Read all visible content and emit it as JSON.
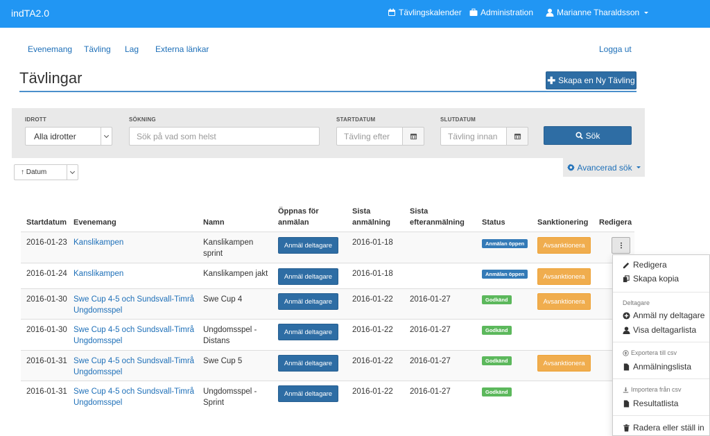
{
  "app": {
    "title": "indTA2.0",
    "nav": {
      "calendar": "Tävlingskalender",
      "admin": "Administration",
      "user": "Marianne Tharaldsson"
    }
  },
  "subnav": {
    "items": [
      "Evenemang",
      "Tävling",
      "Lag",
      "Externa länkar"
    ],
    "logout": "Logga ut"
  },
  "page": {
    "title": "Tävlingar",
    "create_button": "Skapa en Ny Tävling"
  },
  "search": {
    "sport_label": "IDROTT",
    "sport_value": "Alla idrotter",
    "query_label": "SÖKNING",
    "query_placeholder": "Sök på vad som helst",
    "start_label": "STARTDATUM",
    "start_placeholder": "Tävling efter",
    "end_label": "SLUTDATUM",
    "end_placeholder": "Tävling innan",
    "submit": "Sök",
    "advanced": "Avancerad sök"
  },
  "sort": {
    "value": "↑ Datum"
  },
  "table": {
    "headers": {
      "startdatum": "Startdatum",
      "evenemang": "Evenemang",
      "namn": "Namn",
      "oppnas_1": "Öppnas för",
      "oppnas_2": "anmälan",
      "sista_1": "Sista",
      "sista_2": "anmälning",
      "efter_1": "Sista",
      "efter_2": "efteranmälning",
      "status": "Status",
      "sanktionering": "Sanktionering",
      "redigera": "Redigera"
    },
    "register_label": "Anmäl deltagare",
    "sanction_label": "Avsanktionera",
    "rows": [
      {
        "start": "2016-01-23",
        "event_1": "Kanslikampen",
        "event_2": "",
        "name_1": "Kanslikampen",
        "name_2": "sprint",
        "deadline": "2016-01-18",
        "late": "",
        "status": "Anmälan öppen",
        "sanction": "Avsanktionera"
      },
      {
        "start": "2016-01-24",
        "event_1": "Kanslikampen",
        "event_2": "",
        "name_1": "Kanslikampen jakt",
        "name_2": "",
        "deadline": "2016-01-18",
        "late": "",
        "status": "Anmälan öppen",
        "sanction": "Avsanktionera"
      },
      {
        "start": "2016-01-30",
        "event_1": "Swe Cup 4-5 och Sundsvall-Timrå",
        "event_2": "Ungdomsspel",
        "name_1": "Swe Cup 4",
        "name_2": "",
        "deadline": "2016-01-22",
        "late": "2016-01-27",
        "status": "Godkänd",
        "sanction": "Avsanktionera"
      },
      {
        "start": "2016-01-30",
        "event_1": "Swe Cup 4-5 och Sundsvall-Timrå",
        "event_2": "Ungdomsspel",
        "name_1": "Ungdomsspel -",
        "name_2": "Distans",
        "deadline": "2016-01-22",
        "late": "2016-01-27",
        "status": "Godkänd",
        "sanction": ""
      },
      {
        "start": "2016-01-31",
        "event_1": "Swe Cup 4-5 och Sundsvall-Timrå",
        "event_2": "Ungdomsspel",
        "name_1": "Swe Cup 5",
        "name_2": "",
        "deadline": "2016-01-22",
        "late": "2016-01-27",
        "status": "Godkänd",
        "sanction": "Avsanktionera"
      },
      {
        "start": "2016-01-31",
        "event_1": "Swe Cup 4-5 och Sundsvall-Timrå",
        "event_2": "Ungdomsspel",
        "name_1": "Ungdomsspel -",
        "name_2": "Sprint",
        "deadline": "2016-01-22",
        "late": "2016-01-27",
        "status": "Godkänd",
        "sanction": ""
      }
    ]
  },
  "menu": {
    "edit": "Redigera",
    "copy": "Skapa kopia",
    "participants_header": "Deltagare",
    "register_new": "Anmäl ny deltagare",
    "show_list": "Visa deltagarlista",
    "export_header": "Exportera till csv",
    "registration_list": "Anmälningslista",
    "import_header": "Importera från csv",
    "results": "Resultatlista",
    "delete": "Radera eller ställ in"
  },
  "colors": {
    "topbar": "#2196f3",
    "primary": "#2e6da4",
    "link": "#1d6fb8",
    "status_open": "#337ab7",
    "status_approved": "#5cb85c",
    "sanction": "#f0ad4e"
  }
}
